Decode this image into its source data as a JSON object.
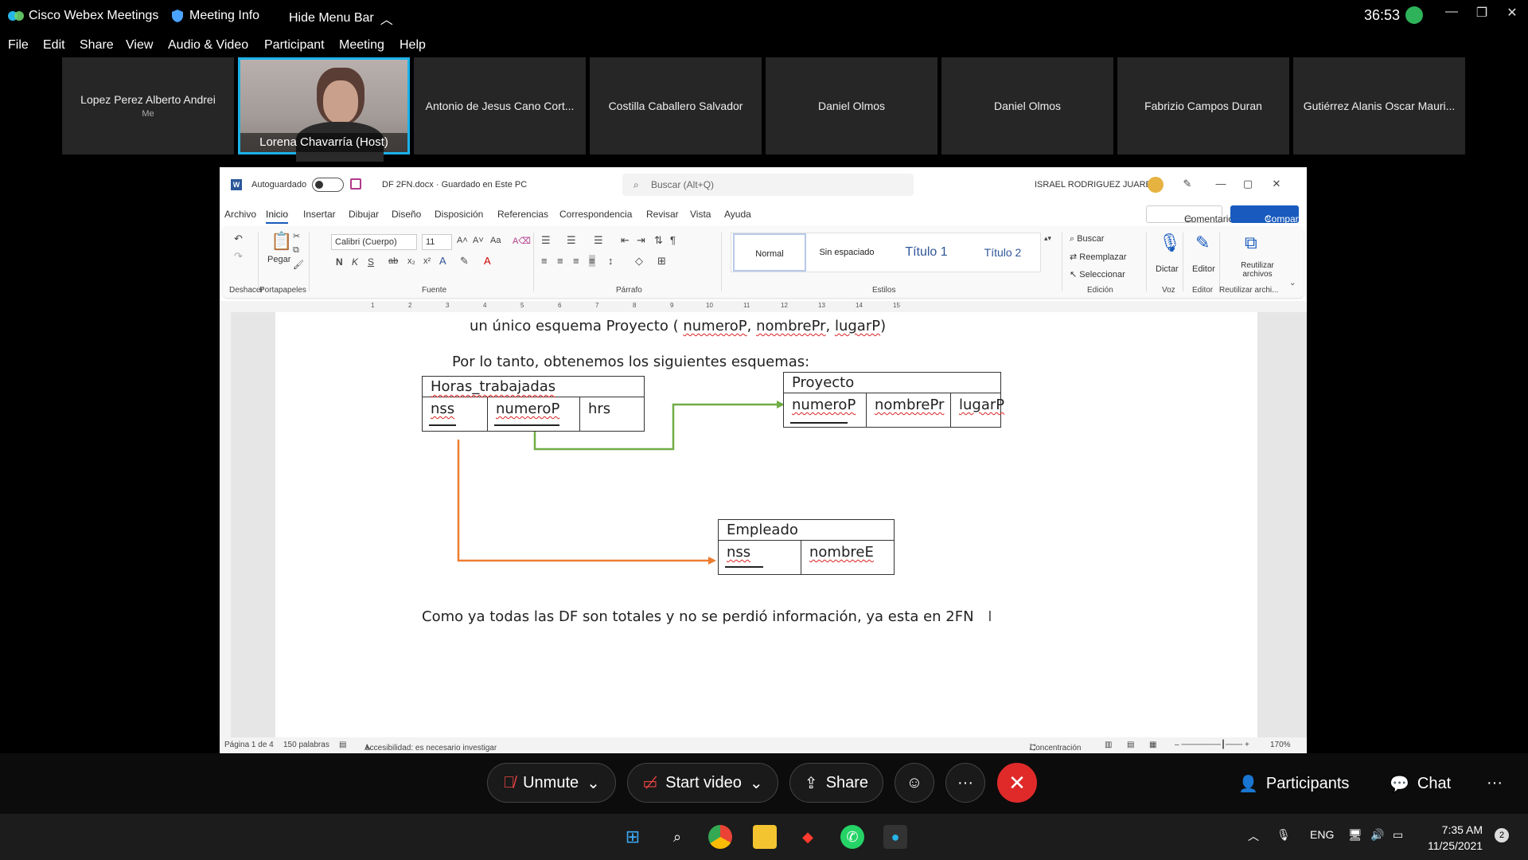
{
  "webex": {
    "app_name": "Cisco Webex Meetings",
    "meeting_info": "Meeting Info",
    "hide_menu": "Hide Menu Bar",
    "timer": "36:53",
    "menu": [
      "File",
      "Edit",
      "Share",
      "View",
      "Audio & Video",
      "Participant",
      "Meeting",
      "Help"
    ]
  },
  "participants": [
    {
      "name": "Lopez Perez Alberto Andrei",
      "sub": "Me"
    },
    {
      "name": "Lorena Chavarría  (Host)",
      "sub": ""
    },
    {
      "name": "Antonio de Jesus Cano Cort...",
      "sub": ""
    },
    {
      "name": "Costilla Caballero Salvador",
      "sub": ""
    },
    {
      "name": "Daniel Olmos",
      "sub": ""
    },
    {
      "name": "Daniel Olmos",
      "sub": ""
    },
    {
      "name": "Fabrizio Campos Duran",
      "sub": ""
    },
    {
      "name": "Gutiérrez Alanis Oscar Mauri...",
      "sub": ""
    }
  ],
  "word": {
    "autosave": "Autoguardado",
    "docname": "DF 2FN.docx  ·  Guardado en Este PC",
    "search_placeholder": "Buscar (Alt+Q)",
    "user": "ISRAEL RODRIGUEZ JUAREZ",
    "tabs": [
      "Archivo",
      "Inicio",
      "Insertar",
      "Dibujar",
      "Diseño",
      "Disposición",
      "Referencias",
      "Correspondencia",
      "Revisar",
      "Vista",
      "Ayuda"
    ],
    "comentarios": "Comentarios",
    "compartir": "Compartir",
    "ribbon": {
      "deshacer": "Deshacer",
      "pegar": "Pegar",
      "portapapeles": "Portapapeles",
      "font": "Calibri (Cuerpo)",
      "size": "11",
      "fuente": "Fuente",
      "parrafo": "Párrafo",
      "styles": [
        "Normal",
        "Sin espaciado",
        "Título 1",
        "Título 2"
      ],
      "estilos": "Estilos",
      "buscar": "Buscar",
      "reemplazar": "Reemplazar",
      "seleccionar": "Seleccionar",
      "edicion": "Edición",
      "dictar": "Dictar",
      "voz": "Voz",
      "editor": "Editor",
      "editor_grp": "Editor",
      "reutilizar": "Reutilizar archivos",
      "reutilizar_grp": "Reutilizar archi..."
    },
    "ruler_numbers": [
      "1",
      "2",
      "3",
      "4",
      "5",
      "6",
      "7",
      "8",
      "9",
      "10",
      "11",
      "12",
      "13",
      "14",
      "15"
    ],
    "doc": {
      "line1_prefix": "un único esquema Proyecto ( ",
      "line1_a": "numeroP",
      "line1_b": "nombrePr",
      "line1_c": "lugarP",
      "line1_suffix": ")",
      "line2": "Por lo tanto, obtenemos los siguientes esquemas:",
      "conclusion": "Como ya todas las DF son totales y no se perdió información, ya esta en 2FN",
      "tables": {
        "horas": {
          "title": "Horas_trabajadas",
          "cols": [
            "nss",
            "numeroP",
            "hrs"
          ]
        },
        "proyecto": {
          "title": "Proyecto",
          "cols": [
            "numeroP",
            "nombrePr",
            "lugarP"
          ]
        },
        "empleado": {
          "title": "Empleado",
          "cols": [
            "nss",
            "nombreE"
          ]
        }
      },
      "arrow_colors": {
        "green": "#70ad47",
        "orange": "#ed7d31"
      }
    },
    "status": {
      "page": "Página 1 de 4",
      "words": "150 palabras",
      "accessibility": "Accesibilidad: es necesario investigar",
      "focus": "Concentración",
      "zoom": "170%"
    }
  },
  "controls": {
    "unmute": "Unmute",
    "start_video": "Start video",
    "share": "Share",
    "participants": "Participants",
    "chat": "Chat"
  },
  "taskbar": {
    "lang": "ENG",
    "time": "7:35 AM",
    "date": "11/25/2021",
    "notifications": "2"
  },
  "colors": {
    "accent_blue": "#185abd",
    "end_red": "#e02a2a",
    "host_border": "#1bb2e8"
  }
}
